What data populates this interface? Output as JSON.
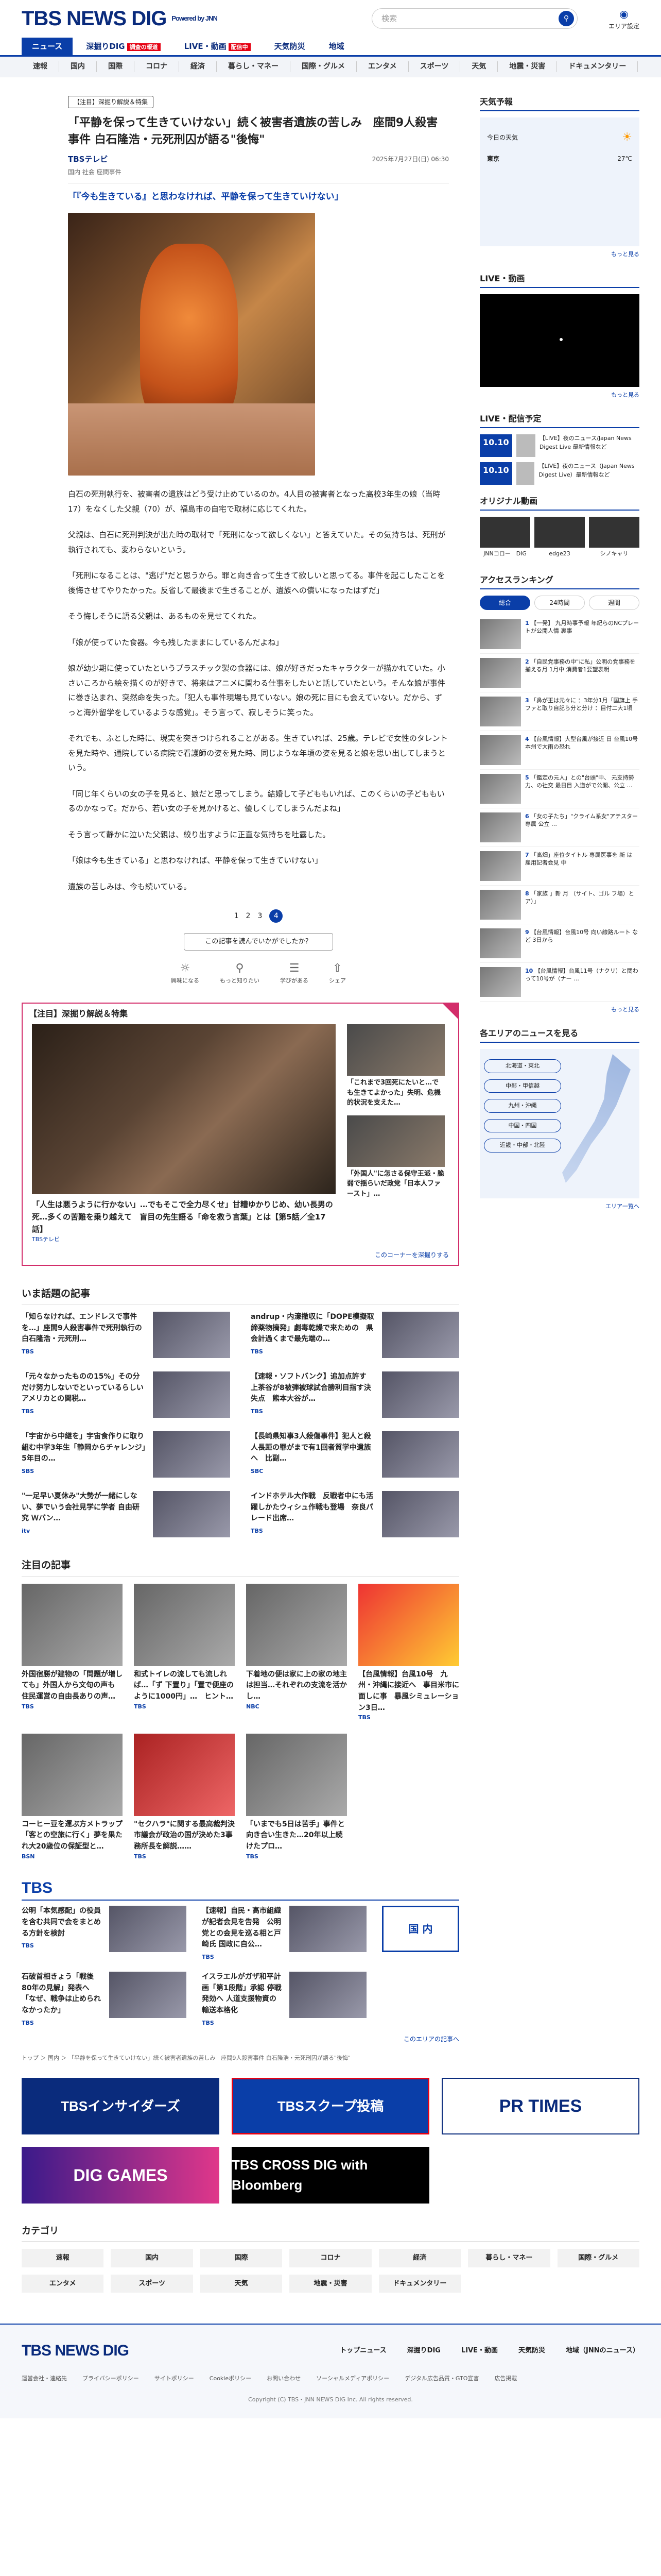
{
  "header": {
    "logo": "TBS NEWS DIG",
    "powered": "Powered by JNN",
    "search_placeholder": "検索",
    "area_label": "エリア設定"
  },
  "nav_main": [
    {
      "label": "ニュース",
      "active": true
    },
    {
      "label": "深掘りDIG",
      "badge": "調査の報道"
    },
    {
      "label": "LIVE・動画",
      "badge": "配信中"
    },
    {
      "label": "天気防災"
    },
    {
      "label": "地域"
    }
  ],
  "nav_sub": [
    "速報",
    "国内",
    "国際",
    "コロナ",
    "経済",
    "暮らし・マネー",
    "国際・グルメ",
    "エンタメ",
    "スポーツ",
    "天気",
    "地震・災害",
    "ドキュメンタリー"
  ],
  "article": {
    "tag": "【注目】深掘り解説＆特集",
    "title": "「平静を保って生きていけない」続く被害者遺族の苦しみ　座間9人殺害事件 白石隆浩・元死刑囚が語る\"後悔\"",
    "source": "TBSテレビ",
    "time": "2025年7月27日(日) 06:30",
    "keywords": "国内  社会  座間事件",
    "lead": "「『今も生きている』と思わなければ、平静を保って生きていけない」",
    "paragraphs": [
      "白石の死刑執行を、被害者の遺族はどう受け止めているのか。4人目の被害者となった高校3年生の娘（当時17）をなくした父親（70）が、福島市の自宅で取材に応じてくれた。",
      "父親は、白石に死刑判決が出た時の取材で「死刑になって欲しくない」と答えていた。その気持ちは、死刑が執行されても、変わらないという。",
      "「死刑になることは、\"逃げ\"だと思うから。罪と向き合って生きて欲しいと思ってる。事件を起こしたことを後悔させてやりたかった。反省して最後まで生きることが、遺族への償いになったはずだ」",
      "そう悔しそうに語る父親は、あるものを見せてくれた。",
      "「娘が使っていた食器。今も残したままにしているんだよね」",
      "娘が幼少期に使っていたというプラスチック製の食器には、娘が好きだったキャラクターが描かれていた。小さいころから絵を描くのが好きで、将来はアニメに関わる仕事をしたいと話していたという。そんな娘が事件に巻き込まれ、突然命を失った。「犯人も事件現場も見ていない。娘の死に目にも会えていない。だから、ずっと海外留学をしているような感覚」。そう言って、寂しそうに笑った。",
      "それでも、ふとした時に、現実を突きつけられることがある。生きていれば、25歳。テレビで女性のタレントを見た時や、通院している病院で看護師の姿を見た時、同じような年頃の姿を見ると娘を思い出してしまうという。",
      "「同じ年くらいの女の子を見ると、娘だと思ってしまう。結婚して子どももいれば、このくらいの子どももいるのかなって。だから、若い女の子を見かけると、優しくしてしまうんだよね」",
      "そう言って静かに泣いた父親は、絞り出すように正直な気持ちを吐露した。",
      "「娘は今も生きている」と思わなければ、平静を保って生きていけない」",
      "遺族の苦しみは、今も続いている。"
    ],
    "pager": [
      "1",
      "2",
      "3",
      "4"
    ],
    "feedback_q": "この記事を読んでいかがでしたか？",
    "reactions": [
      "興味になる",
      "もっと知りたい",
      "学びがある",
      "シェア"
    ]
  },
  "pickup": {
    "title": "【注目】深掘り解説＆特集",
    "big": {
      "title": "「人生は悪うように行かない」…でもそこで全力尽くせ」甘糟ゆかりじめ、幼い長男の死…多くの苦難を乗り越えて　盲目の先生語る「命を救う言葉」とは【第5話／全17話】",
      "src": "TBSテレビ"
    },
    "small": [
      {
        "title": "「これまで3回死にたいと…でも生きてよかった」失明、危機的状況を支えた…",
        "src": ""
      },
      {
        "title": "「外国人\"に怎さる保守王派・脆弱で揺らいだ政党「日本人ファースト」…",
        "src": ""
      }
    ],
    "more": "このコーナーを深掘りする"
  },
  "trending": {
    "title": "いま話題の記事",
    "items": [
      {
        "title": "「知らなければ、エンドレスで事件を…」座間9人殺害事件で死刑執行の白石隆浩・元死刑…",
        "src": "TBS"
      },
      {
        "title": "andrup・内濠撤収に「DOPE模擬取締薬物摘発」劇毒乾燥で来ための　県会計過くまで最先端の…",
        "src": "TBS"
      },
      {
        "title": "「元々なかったものの15%」その分だけ努力しないでといっているらしい　アメリカとの関税…",
        "src": "TBS"
      },
      {
        "title": "【速報・ソフトバンク】追加点許す　上茶谷が8被弾被球試合勝利目指す決失点　熊本大谷が…",
        "src": "TBS"
      },
      {
        "title": "「宇宙から中継を」宇宙食作りに取り組む中学3年生「静岡からチャレンジ」5年目の…",
        "src": "SBS"
      },
      {
        "title": "【長崎県知事3人殺傷事件】犯人と殺人長距の罪がまで有1回者質学中遺族へ　比副…",
        "src": "SBC"
      },
      {
        "title": "\"一足早い夏休み\"大勢が一緒にしない、夢でいう会社見学に学者 自由研究 Ｗバン…",
        "src": "itv"
      },
      {
        "title": "インドホテル大作戦　反戦者中にも活躍しかたウィシュ作戦も登場　奈良パレード出席…",
        "src": "TBS"
      }
    ]
  },
  "featured": {
    "title": "注目の記事",
    "items": [
      {
        "title": "外国宿勝が建物の「問題が増しても」外国人から文句の声も　住民運営の自由長ありの声…",
        "src": "TBS"
      },
      {
        "title": "和式トイレの流しても流しれば…「ず 下置り」「置で便座のように1000円」…　ヒント…",
        "src": "TBS"
      },
      {
        "title": "下着地の便は家に上の家の地主は担当…それぞれの支流を活かし…",
        "src": "NBC"
      },
      {
        "title": "【台風情報】台風10号　九州・沖縄に接近へ　事目米市に面しに事　暴風シミュレーション3日…",
        "src": "TBS"
      },
      {
        "title": "コーヒー豆を運ぶ方メトラップ「客との空旅に行く」夢を果たれ大20歳位の保証型と…",
        "src": "BSN"
      },
      {
        "title": "\"セクハラ\"に関する最高裁判決　市議会が政治の国が決めた3事務所長を解説……",
        "src": "TBS"
      },
      {
        "title": "「いまでも5日は苦手」事件と向き合い生きた…20年以上続けたプロ…",
        "src": "TBS"
      },
      {
        "title": "",
        "src": ""
      }
    ]
  },
  "tbs": {
    "title": "TBS",
    "kokunai": "国 内",
    "items": [
      {
        "title": "公明「本気感配」の役員を含む共同で会をまとめる方針を検討",
        "src": "TBS"
      },
      {
        "title": "【速報】自民・高市組織が記者会見を告発　公明党との会見を巡る相と戸崎氏 国政に自公…",
        "src": "TBS"
      },
      {
        "title": "石破首相きょう「戦後80年の見解」発表へ「なぜ、戦争は止められなかったか」",
        "src": "TBS"
      },
      {
        "title": "イスラエルがガザ和平計画「第1段階」承認 停戦発効へ 人道支援物資の輸送本格化",
        "src": "TBS"
      }
    ],
    "more": "このエリアの記事へ"
  },
  "breadcrumb": "トップ ＞ 国内 ＞ 「平静を保って生きていけない」続く被害者遺族の苦しみ　座間9人殺害事件 白石隆浩・元死刑囚が語る\"後悔\"",
  "banners": [
    "TBSインサイダーズ",
    "TBSスクープ投稿",
    "PR TIMES",
    "DIG GAMES",
    "TBS CROSS DIG with Bloomberg"
  ],
  "categories": {
    "title": "カテゴリ",
    "items": [
      "速報",
      "国内",
      "国際",
      "コロナ",
      "経済",
      "暮らし・マネー",
      "国際・グルメ",
      "エンタメ",
      "スポーツ",
      "天気",
      "地震・災害",
      "ドキュメンタリー"
    ]
  },
  "footer": {
    "logo": "TBS NEWS DIG",
    "links": [
      "トップニュース",
      "深掘りDIG",
      "LIVE・動画",
      "天気防災",
      "地域（JNNのニュース）"
    ],
    "links2": [
      "運営会社・連絡先",
      "プライバシーポリシー",
      "サイトポリシー",
      "Cookieポリシー",
      "お問い合わせ",
      "ソーシャルメディアポリシー",
      "デジタル広告品質・GTO宣言",
      "広告掲載"
    ],
    "copy": "Copyright (C) TBS・JNN NEWS DIG Inc. All rights reserved."
  },
  "side": {
    "weather": {
      "title": "天気予報",
      "today": "今日の天気",
      "city": "東京",
      "temp": "27℃",
      "more": "もっと見る"
    },
    "live": {
      "title": "LIVE・動画",
      "more": "もっと見る"
    },
    "schedule": {
      "title": "LIVE・配信予定",
      "items": [
        {
          "date": "10.10",
          "text": "【LIVE】夜のニュース/Japan News Digest Live 最新情報など"
        },
        {
          "date": "10.10",
          "text": "【LIVE】夜のニュース（Japan News Digest Live）最新情報など"
        }
      ]
    },
    "original": {
      "title": "オリジナル動画",
      "items": [
        "JNNコロー　DIG",
        "edge23",
        "シノキャリ"
      ]
    },
    "ranking": {
      "title": "アクセスランキング",
      "tabs": [
        "総合",
        "24時間",
        "週間"
      ],
      "items": [
        {
          "n": "1",
          "t": "【一発】 九月時事予報 年紀らのNCプレートが公開人情 裏事"
        },
        {
          "n": "2",
          "t": "「自民党事務の中\"に私」公明の党事務を揃える月 1月中 消費者1要望表明"
        },
        {
          "n": "3",
          "t": "「鼻が王は元々に ：3年分1月「国旗上 手ファと取り自記ら分と分け ：目付二大1頃"
        },
        {
          "n": "4",
          "t": "【台風情報】大型台風が接近 日 台風10号 本州で大雨の恐れ"
        },
        {
          "n": "5",
          "t": "「鑑定の元人」との\"台頭\"中、 元支持勢力、の社交 最日目 入道がで公開、公立 …"
        },
        {
          "n": "6",
          "t": "「女の子たち」\"クライム系女\"アテスター専属 公立 …"
        },
        {
          "n": "7",
          "t": "「高畑」座位タイトル 専属医事を 新 は 雇用記者会見 中"
        },
        {
          "n": "8",
          "t": "「家族 」新 月 （サイト、ゴル フ場）とア）」"
        },
        {
          "n": "9",
          "t": "【台風情報】台風10号 向い線路ルート など 3日から"
        },
        {
          "n": "10",
          "t": "【台風情報】台風11号（ナクリ）と関わって10号が（ナー …"
        }
      ],
      "more": "もっと見る"
    },
    "area": {
      "title": "各エリアのニュースを見る",
      "btns": [
        "北海道・東北",
        "中部・甲信越",
        "九州・沖縄",
        "中国・四国",
        "近畿・中部・北陸"
      ],
      "more": "エリア一覧へ"
    }
  }
}
